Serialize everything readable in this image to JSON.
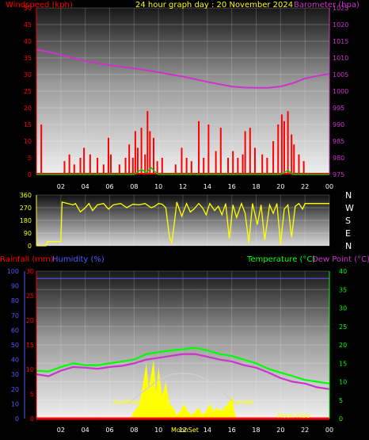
{
  "header": {
    "title": "24 hour graph day : 20 November 2024",
    "left_label": "Windspeed (kph)",
    "right_label": "Barometer (hpa)"
  },
  "colors": {
    "wind": "#ff0000",
    "gust": "#ff0000",
    "barometer": "#cc33cc",
    "direction": "#ffff00",
    "rain": "#ff0000",
    "humidity": "#5555ff",
    "temperature": "#00ff00",
    "dewpoint": "#cc33cc",
    "solar": "#ffff00",
    "sun_arc": "#cfcfcf",
    "grid": "#ffffff"
  },
  "chart_data": [
    {
      "id": "wind-barometer",
      "type": "line",
      "title": "24 hour graph day : 20 November 2024",
      "xlabel": "",
      "ylabel": "Windspeed (kph)",
      "ylabel_right": "Barometer (hpa)",
      "x_ticks": [
        "02",
        "04",
        "06",
        "08",
        "10",
        "12",
        "14",
        "16",
        "18",
        "20",
        "22",
        "00"
      ],
      "ylim": [
        0,
        50
      ],
      "y_ticks": [
        0,
        5,
        10,
        15,
        20,
        25,
        30,
        35,
        40,
        45,
        50
      ],
      "ylim_right": [
        975,
        1025
      ],
      "y_ticks_right": [
        975,
        980,
        985,
        990,
        995,
        1000,
        1005,
        1010,
        1015,
        1020,
        1025
      ],
      "grid": true,
      "series": [
        {
          "name": "Windspeed (kph)",
          "kind": "bars",
          "axis": "left",
          "x": [
            0.4,
            2.3,
            2.7,
            3.1,
            3.6,
            3.9,
            4.4,
            5.0,
            5.5,
            5.9,
            6.1,
            6.8,
            7.3,
            7.6,
            7.9,
            8.1,
            8.3,
            8.6,
            8.9,
            9.1,
            9.3,
            9.6,
            9.9,
            10.3,
            11.4,
            11.9,
            12.3,
            12.7,
            13.3,
            13.7,
            14.1,
            14.7,
            15.1,
            15.7,
            16.1,
            16.5,
            16.9,
            17.1,
            17.5,
            17.9,
            18.5,
            18.9,
            19.4,
            19.8,
            20.1,
            20.3,
            20.6,
            20.9,
            21.1,
            21.5,
            21.9
          ],
          "values": [
            15,
            4,
            6,
            3,
            5,
            8,
            6,
            5,
            3,
            11,
            6,
            3,
            5,
            9,
            5,
            13,
            8,
            14,
            6,
            19,
            13,
            11,
            4,
            5,
            3,
            8,
            5,
            4,
            16,
            5,
            15,
            7,
            14,
            5,
            7,
            5,
            6,
            13,
            14,
            8,
            6,
            5,
            10,
            15,
            18,
            16,
            19,
            12,
            9,
            6,
            4
          ]
        },
        {
          "name": "Gust",
          "kind": "line",
          "axis": "left",
          "x": [
            0,
            2,
            4,
            6,
            8,
            8.6,
            9,
            9.4,
            9.8,
            10,
            12,
            14,
            16,
            20,
            20.6,
            21,
            22,
            24
          ],
          "values": [
            0,
            0,
            0,
            0,
            0,
            1.5,
            0.5,
            2,
            0.5,
            0,
            0,
            0,
            0,
            0,
            1.2,
            0,
            0,
            0
          ]
        },
        {
          "name": "Barometer (hpa)",
          "kind": "line",
          "axis": "right",
          "x": [
            0,
            1,
            2,
            3,
            4,
            5,
            6,
            7,
            8,
            9,
            10,
            11,
            12,
            13,
            14,
            15,
            16,
            17,
            18,
            19,
            20,
            21,
            22,
            23,
            24
          ],
          "values": [
            1012.5,
            1011.8,
            1010.9,
            1010,
            1009,
            1008.4,
            1007.8,
            1007.3,
            1006.8,
            1006.3,
            1005.7,
            1005,
            1004.4,
            1003.6,
            1002.8,
            1002.1,
            1001.4,
            1001.1,
            1001,
            1001,
            1001.4,
            1002.4,
            1003.8,
            1004.6,
            1005.2
          ]
        }
      ]
    },
    {
      "id": "wind-direction",
      "type": "line",
      "xlabel": "",
      "ylim": [
        0,
        360
      ],
      "y_ticks": [
        0,
        90,
        180,
        270,
        360
      ],
      "compass_labels": [
        "N",
        "W",
        "S",
        "E",
        "N"
      ],
      "grid": true,
      "series": [
        {
          "name": "Wind direction",
          "x": [
            0,
            0.8,
            0.9,
            2.0,
            2.1,
            3.0,
            3.2,
            3.6,
            4.0,
            4.3,
            4.6,
            5.0,
            5.5,
            5.9,
            6.3,
            6.9,
            7.4,
            7.9,
            8.4,
            8.9,
            9.4,
            9.7,
            10.0,
            10.3,
            10.6,
            10.9,
            11.1,
            11.5,
            11.9,
            12.3,
            12.6,
            12.9,
            13.3,
            13.6,
            13.9,
            14.2,
            14.6,
            14.9,
            15.2,
            15.5,
            15.8,
            16.1,
            16.4,
            16.8,
            17.1,
            17.4,
            17.7,
            18.1,
            18.4,
            18.7,
            19.1,
            19.4,
            19.7,
            20.0,
            20.3,
            20.6,
            20.9,
            21.2,
            21.5,
            21.8,
            22.0,
            22.5,
            24
          ],
          "values": [
            0,
            0,
            30,
            30,
            310,
            290,
            300,
            240,
            270,
            300,
            250,
            290,
            300,
            260,
            290,
            300,
            270,
            295,
            290,
            300,
            270,
            280,
            300,
            295,
            270,
            60,
            20,
            310,
            210,
            300,
            240,
            260,
            300,
            270,
            220,
            300,
            250,
            280,
            220,
            300,
            50,
            290,
            200,
            300,
            230,
            20,
            300,
            150,
            290,
            40,
            290,
            230,
            300,
            10,
            260,
            290,
            60,
            280,
            300,
            260,
            300,
            300,
            300
          ]
        }
      ]
    },
    {
      "id": "temp-humidity-rain",
      "type": "line",
      "xlabel": "",
      "legend": [
        "Rainfall (mm)",
        "Humidity (%)",
        "Temperature (°C)",
        "Dew Point (°C)"
      ],
      "x_ticks": [
        "02",
        "04",
        "06",
        "08",
        "10",
        "12",
        "14",
        "16",
        "18",
        "20",
        "22",
        "00"
      ],
      "ylim_humidity": [
        0,
        100
      ],
      "y_ticks_humidity": [
        0,
        10,
        20,
        30,
        40,
        50,
        60,
        70,
        80,
        90,
        100
      ],
      "ylim_rain": [
        0,
        30
      ],
      "y_ticks_rain": [
        0,
        5,
        10,
        15,
        20,
        25,
        30
      ],
      "ylim_temp": [
        0,
        40
      ],
      "y_ticks_temp": [
        0,
        5,
        10,
        15,
        20,
        25,
        30,
        35,
        40
      ],
      "annotations": [
        "SunRise",
        "SunSet",
        "MoonSet",
        "Moon Rise"
      ],
      "grid": true,
      "series": [
        {
          "name": "Humidity (%)",
          "axis": "humidity",
          "x": [
            0,
            24
          ],
          "values": [
            95,
            95
          ]
        },
        {
          "name": "Rainfall (mm)",
          "axis": "rain",
          "x": [
            0,
            24
          ],
          "values": [
            0,
            0
          ]
        },
        {
          "name": "Temperature (°C)",
          "axis": "temp",
          "x": [
            0,
            1,
            2,
            3,
            4,
            5,
            6,
            7,
            8,
            9,
            10,
            11,
            12,
            13,
            14,
            15,
            16,
            17,
            18,
            19,
            20,
            21,
            22,
            23,
            24
          ],
          "values": [
            13,
            12.8,
            14,
            15,
            14.5,
            14.5,
            15,
            15.5,
            16,
            17.5,
            18,
            18.5,
            18.8,
            19.2,
            18.5,
            17.5,
            17,
            16,
            15,
            13.5,
            12.5,
            11.5,
            10.5,
            10,
            9.5
          ]
        },
        {
          "name": "Dew Point (°C)",
          "axis": "temp",
          "x": [
            0,
            1,
            2,
            3,
            4,
            5,
            6,
            7,
            8,
            9,
            10,
            11,
            12,
            13,
            14,
            15,
            16,
            17,
            18,
            19,
            20,
            21,
            22,
            23,
            24
          ],
          "values": [
            12,
            11.5,
            13,
            14,
            13.8,
            13.5,
            14,
            14.3,
            15,
            16,
            16.5,
            17,
            17.5,
            17.5,
            16.8,
            16,
            15.5,
            14.5,
            13.8,
            12.5,
            11,
            10,
            9.5,
            8.5,
            8
          ]
        },
        {
          "name": "Solar radiation",
          "axis": "temp",
          "kind": "area",
          "x": [
            7.7,
            8.0,
            8.3,
            8.5,
            8.8,
            9.0,
            9.2,
            9.4,
            9.6,
            9.8,
            10.0,
            10.3,
            10.6,
            10.9,
            11.2,
            11.5,
            11.8,
            12.1,
            12.4,
            12.7,
            13.0,
            13.3,
            13.6,
            13.9,
            14.2,
            14.5,
            14.8,
            15.1,
            15.4,
            15.7,
            16.0,
            16.2,
            16.4
          ],
          "values": [
            0,
            2,
            3,
            5,
            11,
            15,
            8,
            12,
            16,
            7,
            14,
            6,
            10,
            4,
            3,
            1,
            2,
            4,
            2,
            1,
            2,
            3,
            1,
            2,
            4,
            2,
            3,
            2,
            3,
            4,
            6,
            2,
            0
          ]
        },
        {
          "name": "Sun elevation",
          "axis": "temp",
          "kind": "line",
          "x": [
            7.5,
            9,
            10,
            11,
            12,
            13,
            14,
            15,
            16.3
          ],
          "values": [
            4,
            8,
            10.5,
            12,
            12.3,
            12,
            10.5,
            8,
            4
          ]
        }
      ]
    }
  ]
}
